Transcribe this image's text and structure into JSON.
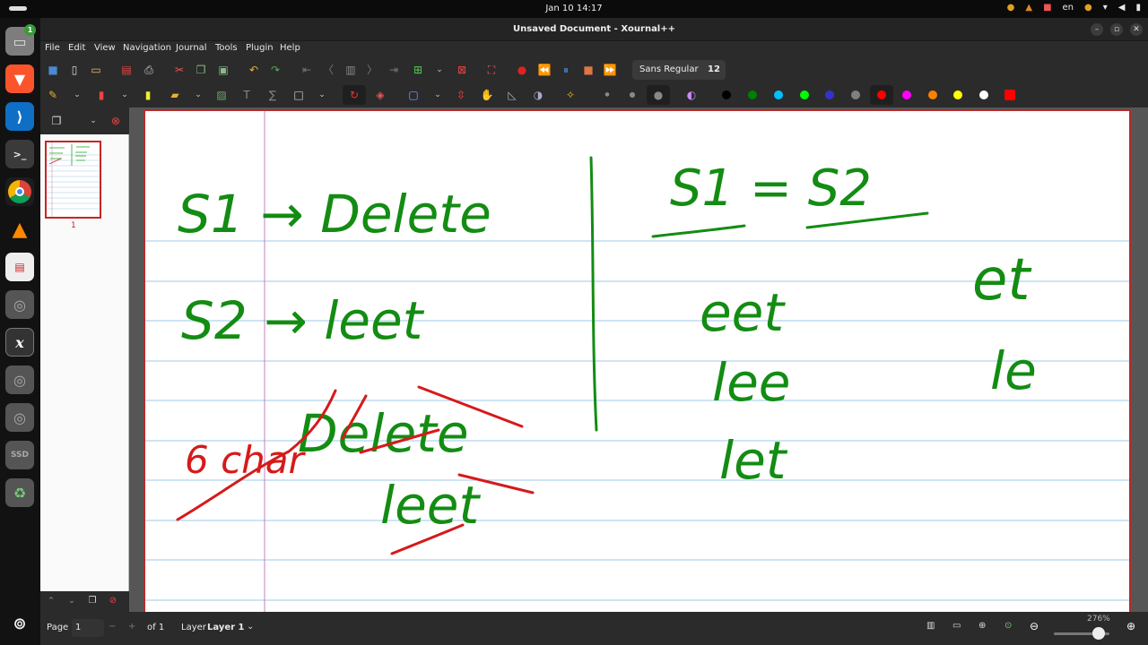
{
  "system": {
    "clock": "Jan 10  14:17",
    "language": "en",
    "dock_badge": "1",
    "dock_apps": [
      "files-icon",
      "brave-icon",
      "vscode-icon",
      "terminal-icon",
      "chrome-icon",
      "vlc-icon",
      "document-viewer-icon",
      "disk-icon",
      "xournal-icon",
      "disk-icon",
      "disk-icon",
      "ssd-icon",
      "trash-icon",
      "app-grid-icon"
    ]
  },
  "window": {
    "title": "Unsaved Document - Xournal++"
  },
  "menu": [
    "File",
    "Edit",
    "View",
    "Navigation",
    "Journal",
    "Tools",
    "Plugin",
    "Help"
  ],
  "toolbar": {
    "font_name": "Sans Regular",
    "font_size": "12"
  },
  "palette": [
    "#000000",
    "#008000",
    "#00c0ff",
    "#00ff00",
    "#3333cc",
    "#808080",
    "#ff0000",
    "#ff00ff",
    "#ff8000",
    "#ffff00",
    "#ffffff",
    "#ff0000"
  ],
  "sidebar": {
    "page_number_label": "1"
  },
  "statusbar": {
    "page_label": "Page",
    "page_value": "1",
    "of_label": "of 1",
    "layer_label": "Layer",
    "layer_value": "Layer 1",
    "zoom": "276%"
  },
  "ink": {
    "left_line1": "S1 → Delete",
    "left_line2": "S2 → leet",
    "annotation": "6 char",
    "struck_word": "Delete",
    "struck_word2": "leet",
    "right_header": "S1 = S2",
    "right_col1": [
      "eet",
      "lee",
      "let"
    ],
    "right_col2": [
      "et",
      "le"
    ]
  }
}
